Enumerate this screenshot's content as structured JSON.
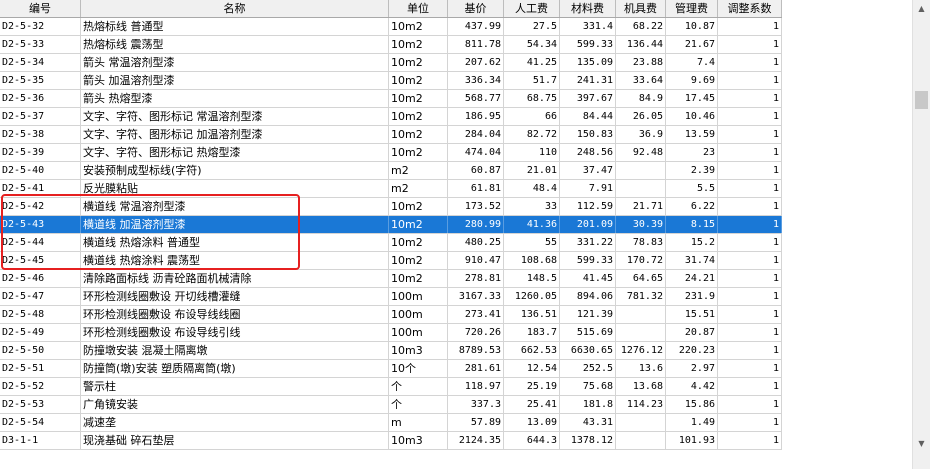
{
  "columns": [
    "编号",
    "名称",
    "单位",
    "基价",
    "人工费",
    "材料费",
    "机具费",
    "管理费",
    "调整系数"
  ],
  "rows": [
    {
      "code": "D2-5-32",
      "name": "热熔标线 普通型",
      "unit": "10m2",
      "base": "437.99",
      "labor": "27.5",
      "material": "331.4",
      "machine": "68.22",
      "mgmt": "10.87",
      "coef": "1"
    },
    {
      "code": "D2-5-33",
      "name": "热熔标线 震荡型",
      "unit": "10m2",
      "base": "811.78",
      "labor": "54.34",
      "material": "599.33",
      "machine": "136.44",
      "mgmt": "21.67",
      "coef": "1"
    },
    {
      "code": "D2-5-34",
      "name": "箭头 常温溶剂型漆",
      "unit": "10m2",
      "base": "207.62",
      "labor": "41.25",
      "material": "135.09",
      "machine": "23.88",
      "mgmt": "7.4",
      "coef": "1"
    },
    {
      "code": "D2-5-35",
      "name": "箭头 加温溶剂型漆",
      "unit": "10m2",
      "base": "336.34",
      "labor": "51.7",
      "material": "241.31",
      "machine": "33.64",
      "mgmt": "9.69",
      "coef": "1"
    },
    {
      "code": "D2-5-36",
      "name": "箭头 热熔型漆",
      "unit": "10m2",
      "base": "568.77",
      "labor": "68.75",
      "material": "397.67",
      "machine": "84.9",
      "mgmt": "17.45",
      "coef": "1"
    },
    {
      "code": "D2-5-37",
      "name": "文字、字符、图形标记 常温溶剂型漆",
      "unit": "10m2",
      "base": "186.95",
      "labor": "66",
      "material": "84.44",
      "machine": "26.05",
      "mgmt": "10.46",
      "coef": "1"
    },
    {
      "code": "D2-5-38",
      "name": "文字、字符、图形标记 加温溶剂型漆",
      "unit": "10m2",
      "base": "284.04",
      "labor": "82.72",
      "material": "150.83",
      "machine": "36.9",
      "mgmt": "13.59",
      "coef": "1"
    },
    {
      "code": "D2-5-39",
      "name": "文字、字符、图形标记 热熔型漆",
      "unit": "10m2",
      "base": "474.04",
      "labor": "110",
      "material": "248.56",
      "machine": "92.48",
      "mgmt": "23",
      "coef": "1"
    },
    {
      "code": "D2-5-40",
      "name": "安装预制成型标线(字符)",
      "unit": "m2",
      "base": "60.87",
      "labor": "21.01",
      "material": "37.47",
      "machine": "",
      "mgmt": "2.39",
      "coef": "1"
    },
    {
      "code": "D2-5-41",
      "name": "反光膜粘贴",
      "unit": "m2",
      "base": "61.81",
      "labor": "48.4",
      "material": "7.91",
      "machine": "",
      "mgmt": "5.5",
      "coef": "1"
    },
    {
      "code": "D2-5-42",
      "name": "横道线 常温溶剂型漆",
      "unit": "10m2",
      "base": "173.52",
      "labor": "33",
      "material": "112.59",
      "machine": "21.71",
      "mgmt": "6.22",
      "coef": "1"
    },
    {
      "code": "D2-5-43",
      "name": "横道线 加温溶剂型漆",
      "unit": "10m2",
      "base": "280.99",
      "labor": "41.36",
      "material": "201.09",
      "machine": "30.39",
      "mgmt": "8.15",
      "coef": "1",
      "selected": true
    },
    {
      "code": "D2-5-44",
      "name": "横道线 热熔涂料 普通型",
      "unit": "10m2",
      "base": "480.25",
      "labor": "55",
      "material": "331.22",
      "machine": "78.83",
      "mgmt": "15.2",
      "coef": "1"
    },
    {
      "code": "D2-5-45",
      "name": "横道线 热熔涂料 震荡型",
      "unit": "10m2",
      "base": "910.47",
      "labor": "108.68",
      "material": "599.33",
      "machine": "170.72",
      "mgmt": "31.74",
      "coef": "1"
    },
    {
      "code": "D2-5-46",
      "name": "清除路面标线 沥青砼路面机械清除",
      "unit": "10m2",
      "base": "278.81",
      "labor": "148.5",
      "material": "41.45",
      "machine": "64.65",
      "mgmt": "24.21",
      "coef": "1"
    },
    {
      "code": "D2-5-47",
      "name": "环形检测线圈敷设 开切线槽灌缝",
      "unit": "100m",
      "base": "3167.33",
      "labor": "1260.05",
      "material": "894.06",
      "machine": "781.32",
      "mgmt": "231.9",
      "coef": "1"
    },
    {
      "code": "D2-5-48",
      "name": "环形检测线圈敷设 布设导线线圈",
      "unit": "100m",
      "base": "273.41",
      "labor": "136.51",
      "material": "121.39",
      "machine": "",
      "mgmt": "15.51",
      "coef": "1"
    },
    {
      "code": "D2-5-49",
      "name": "环形检测线圈敷设 布设导线引线",
      "unit": "100m",
      "base": "720.26",
      "labor": "183.7",
      "material": "515.69",
      "machine": "",
      "mgmt": "20.87",
      "coef": "1"
    },
    {
      "code": "D2-5-50",
      "name": "防撞墩安装 混凝土隔离墩",
      "unit": "10m3",
      "base": "8789.53",
      "labor": "662.53",
      "material": "6630.65",
      "machine": "1276.12",
      "mgmt": "220.23",
      "coef": "1"
    },
    {
      "code": "D2-5-51",
      "name": "防撞筒(墩)安装 塑质隔离筒(墩)",
      "unit": "10个",
      "base": "281.61",
      "labor": "12.54",
      "material": "252.5",
      "machine": "13.6",
      "mgmt": "2.97",
      "coef": "1"
    },
    {
      "code": "D2-5-52",
      "name": "警示柱",
      "unit": "个",
      "base": "118.97",
      "labor": "25.19",
      "material": "75.68",
      "machine": "13.68",
      "mgmt": "4.42",
      "coef": "1"
    },
    {
      "code": "D2-5-53",
      "name": "广角镜安装",
      "unit": "个",
      "base": "337.3",
      "labor": "25.41",
      "material": "181.8",
      "machine": "114.23",
      "mgmt": "15.86",
      "coef": "1"
    },
    {
      "code": "D2-5-54",
      "name": "减速垄",
      "unit": "m",
      "base": "57.89",
      "labor": "13.09",
      "material": "43.31",
      "machine": "",
      "mgmt": "1.49",
      "coef": "1"
    },
    {
      "code": "D3-1-1",
      "name": "现浇基础 碎石垫层",
      "unit": "10m3",
      "base": "2124.35",
      "labor": "644.3",
      "material": "1378.12",
      "machine": "",
      "mgmt": "101.93",
      "coef": "1"
    }
  ],
  "colors": {
    "selection": "#1a78d6",
    "highlight_box": "#e62020",
    "header_bg": "#f0f0f0"
  },
  "icons": {
    "scroll_up": "up-arrow-icon",
    "scroll_down": "down-arrow-icon"
  }
}
